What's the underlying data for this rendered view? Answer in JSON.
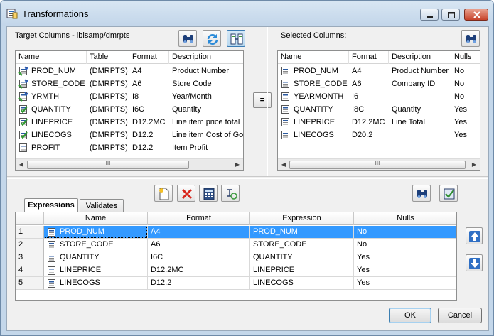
{
  "window": {
    "title": "Transformations"
  },
  "target": {
    "label": "Target Columns - ibisamp/dmrpts",
    "columns": [
      "Name",
      "Table",
      "Format",
      "Description"
    ],
    "rows": [
      {
        "name": "PROD_NUM",
        "table": "(DMRPTS)",
        "format": "A4",
        "description": "Product Number",
        "icon": "key-column-icon"
      },
      {
        "name": "STORE_CODE",
        "table": "(DMRPTS)",
        "format": "A6",
        "description": "Store Code",
        "icon": "key-column-icon"
      },
      {
        "name": "YRMTH",
        "table": "(DMRPTS)",
        "format": "I8",
        "description": "Year/Month",
        "icon": "key-column-icon"
      },
      {
        "name": "QUANTITY",
        "table": "(DMRPTS)",
        "format": "I6C",
        "description": "Quantity",
        "icon": "measure-column-icon"
      },
      {
        "name": "LINEPRICE",
        "table": "(DMRPTS)",
        "format": "D12.2MC",
        "description": "Line item price total",
        "icon": "measure-column-icon"
      },
      {
        "name": "LINECOGS",
        "table": "(DMRPTS)",
        "format": "D12.2",
        "description": "Line item Cost of Goo",
        "icon": "measure-column-icon"
      },
      {
        "name": "PROFIT",
        "table": "(DMRPTS)",
        "format": "D12.2",
        "description": "Item Profit",
        "icon": "column-icon"
      }
    ]
  },
  "selected": {
    "label": "Selected Columns:",
    "columns": [
      "Name",
      "Format",
      "Description",
      "Nulls"
    ],
    "rows": [
      {
        "name": "PROD_NUM",
        "format": "A4",
        "description": "Product Number",
        "nulls": "No"
      },
      {
        "name": "STORE_CODE",
        "format": "A6",
        "description": "Company ID",
        "nulls": "No"
      },
      {
        "name": "YEARMONTH",
        "format": "I6",
        "description": "",
        "nulls": "No"
      },
      {
        "name": "QUANTITY",
        "format": "I8C",
        "description": "Quantity",
        "nulls": "Yes"
      },
      {
        "name": "LINEPRICE",
        "format": "D12.2MC",
        "description": "Line Total",
        "nulls": "Yes"
      },
      {
        "name": "LINECOGS",
        "format": "D20.2",
        "description": "",
        "nulls": "Yes"
      }
    ]
  },
  "map_button": "=",
  "tabs": [
    "Expressions",
    "Validates"
  ],
  "expressions": {
    "columns": [
      "Name",
      "Format",
      "Expression",
      "Nulls"
    ],
    "rows": [
      {
        "num": "1",
        "name": "PROD_NUM",
        "format": "A4",
        "expression": "PROD_NUM",
        "nulls": "No"
      },
      {
        "num": "2",
        "name": "STORE_CODE",
        "format": "A6",
        "expression": "STORE_CODE",
        "nulls": "No"
      },
      {
        "num": "3",
        "name": "QUANTITY",
        "format": "I6C",
        "expression": "QUANTITY",
        "nulls": "Yes"
      },
      {
        "num": "4",
        "name": "LINEPRICE",
        "format": "D12.2MC",
        "expression": "LINEPRICE",
        "nulls": "Yes"
      },
      {
        "num": "5",
        "name": "LINECOGS",
        "format": "D12.2",
        "expression": "LINECOGS",
        "nulls": "Yes"
      }
    ]
  },
  "buttons": {
    "ok": "OK",
    "cancel": "Cancel"
  },
  "scroll_grip": "III"
}
